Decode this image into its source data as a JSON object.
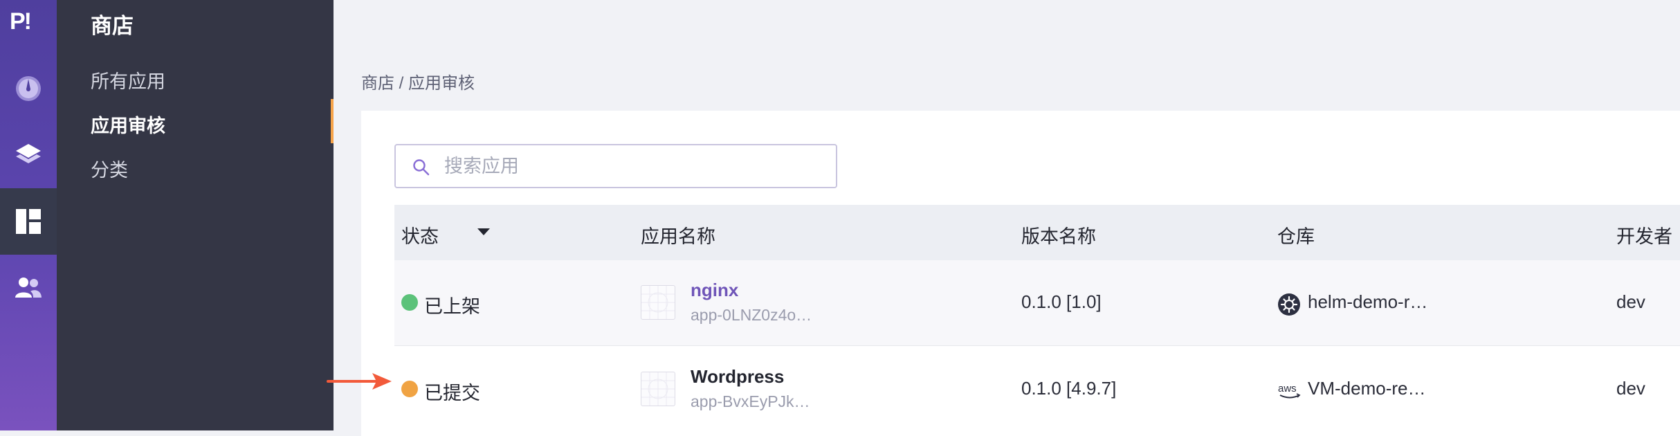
{
  "rail": {
    "logo": "P!",
    "items": [
      {
        "icon": "dashboard-gauge-icon"
      },
      {
        "icon": "layers-icon"
      },
      {
        "icon": "store-layout-icon",
        "active": true
      },
      {
        "icon": "users-icon"
      }
    ]
  },
  "subnav": {
    "title": "商店",
    "items": [
      {
        "label": "所有应用"
      },
      {
        "label": "应用审核",
        "active": true
      },
      {
        "label": "分类"
      }
    ]
  },
  "breadcrumb": "商店 / 应用审核",
  "search": {
    "placeholder": "搜索应用",
    "value": ""
  },
  "table": {
    "headers": {
      "status": "状态",
      "app_name": "应用名称",
      "version": "版本名称",
      "repo": "仓库",
      "developer": "开发者"
    },
    "rows": [
      {
        "status": "已上架",
        "status_color": "#5cc27a",
        "name": "nginx",
        "name_color": "#6f55b8",
        "id": "app-0LNZ0z4o…",
        "version": "0.1.0 [1.0]",
        "repo_icon": "helm-icon",
        "repo": "helm-demo-r…",
        "developer": "dev"
      },
      {
        "status": "已提交",
        "status_color": "#f0a343",
        "name": "Wordpress",
        "name_color": "#23252f",
        "id": "app-BvxEyPJk…",
        "version": "0.1.0 [4.9.7]",
        "repo_icon": "aws-icon",
        "repo": "VM-demo-re…",
        "developer": "dev"
      }
    ]
  },
  "colors": {
    "accent": "#6f55b8",
    "rail": "#5d46b0",
    "annotation_arrow": "#f25a3a",
    "active_bar": "#f6a44a"
  }
}
